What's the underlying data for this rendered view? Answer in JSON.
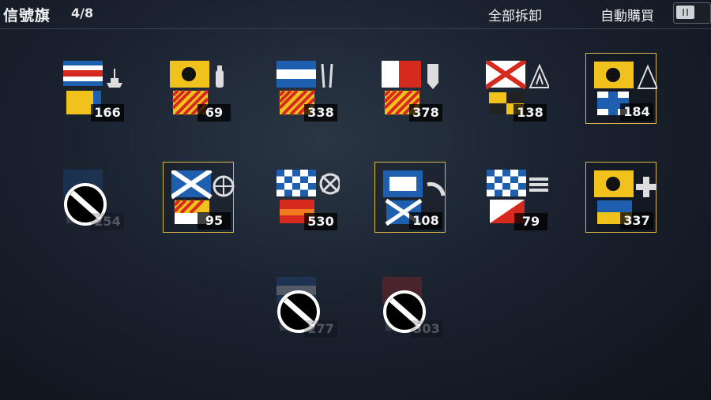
{
  "header": {
    "title": "信號旗",
    "count": "4/8",
    "unmount_all": "全部拆卸",
    "auto_buy": "自動購買"
  },
  "flags": [
    {
      "count": "166",
      "selected": false,
      "disabled": false,
      "top": "charlie",
      "bottom": "yellow-blue",
      "icon": "ship-icon"
    },
    {
      "count": "69",
      "selected": false,
      "disabled": false,
      "top": "india",
      "bottom": "yellow-red-diag",
      "icon": "extinguisher-icon"
    },
    {
      "count": "338",
      "selected": false,
      "disabled": false,
      "top": "juliet",
      "bottom": "yellow-red-diag",
      "icon": "wrench-icon"
    },
    {
      "count": "378",
      "selected": false,
      "disabled": false,
      "top": "red-white",
      "bottom": "yellow-red-diag",
      "icon": "shield-icon"
    },
    {
      "count": "138",
      "selected": false,
      "disabled": false,
      "top": "victor",
      "bottom": "black-yellow",
      "icon": "flame-icon"
    },
    {
      "count": "184",
      "selected": true,
      "disabled": false,
      "top": "india",
      "bottom": "blue-cross",
      "icon": "flame-icon"
    },
    {
      "count": "254",
      "selected": false,
      "disabled": true,
      "top": "blue",
      "bottom": "gray",
      "icon": "none"
    },
    {
      "count": "95",
      "selected": true,
      "disabled": false,
      "top": "saltire",
      "bottom": "yellow-red-diag",
      "icon": "target-icon"
    },
    {
      "count": "530",
      "selected": false,
      "disabled": false,
      "top": "checker",
      "bottom": "red-orange",
      "icon": "crosshair-icon"
    },
    {
      "count": "108",
      "selected": true,
      "disabled": false,
      "top": "blue-white",
      "bottom": "saltire",
      "icon": "radar-icon"
    },
    {
      "count": "79",
      "selected": false,
      "disabled": false,
      "top": "checker",
      "bottom": "red-white-diag",
      "icon": "torpedo-icon"
    },
    {
      "count": "337",
      "selected": true,
      "disabled": false,
      "top": "india",
      "bottom": "yellow-blue",
      "icon": "plus-icon"
    },
    {
      "count": "277",
      "selected": false,
      "disabled": true,
      "top": "blue-white",
      "bottom": "gray",
      "icon": "none"
    },
    {
      "count": "303",
      "selected": false,
      "disabled": true,
      "top": "red",
      "bottom": "gray",
      "icon": "none"
    }
  ]
}
